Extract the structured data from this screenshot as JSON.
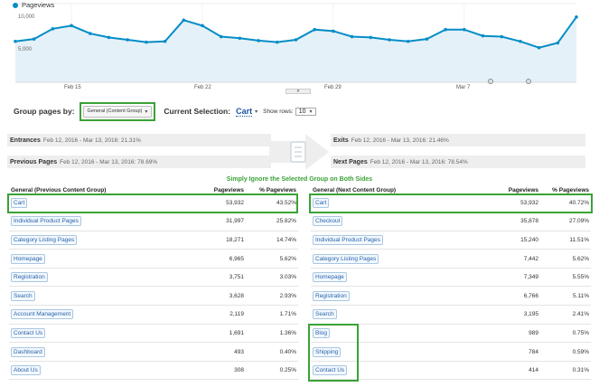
{
  "chart": {
    "legend": "Pageviews",
    "y_ticks": [
      "10,000",
      "5,000"
    ],
    "x_labels": [
      "Feb 15",
      "Feb 22",
      "Feb 29",
      "Mar 7"
    ]
  },
  "chart_data": {
    "type": "area",
    "x": [
      "2016-02-12",
      "2016-02-13",
      "2016-02-14",
      "2016-02-15",
      "2016-02-16",
      "2016-02-17",
      "2016-02-18",
      "2016-02-19",
      "2016-02-20",
      "2016-02-21",
      "2016-02-22",
      "2016-02-23",
      "2016-02-24",
      "2016-02-25",
      "2016-02-26",
      "2016-02-27",
      "2016-02-28",
      "2016-02-29",
      "2016-03-01",
      "2016-03-02",
      "2016-03-03",
      "2016-03-04",
      "2016-03-05",
      "2016-03-06",
      "2016-03-07",
      "2016-03-08",
      "2016-03-09",
      "2016-03-10",
      "2016-03-11",
      "2016-03-12",
      "2016-03-13"
    ],
    "series": [
      {
        "name": "Pageviews",
        "values": [
          5200,
          5500,
          6800,
          7200,
          6200,
          5700,
          5400,
          5100,
          5200,
          7900,
          7200,
          5800,
          5600,
          5300,
          5100,
          5400,
          6700,
          6500,
          5800,
          5700,
          5400,
          5200,
          5500,
          6700,
          6700,
          5900,
          5800,
          5200,
          4400,
          5000,
          8300
        ]
      }
    ],
    "ylim": [
      0,
      10000
    ],
    "y_ticks": [
      5000,
      10000
    ],
    "x_tick_labels": [
      "Feb 15",
      "Feb 22",
      "Feb 29",
      "Mar 7"
    ],
    "grid": true,
    "legend": "top-left"
  },
  "controls": {
    "group_label": "Group pages by:",
    "group_value": "General (Content Group)",
    "selection_label": "Current Selection:",
    "selection_value": "Cart",
    "rows_label": "Show rows:",
    "rows_value": "10"
  },
  "entrances": {
    "label": "Entrances",
    "range": "Feb 12, 2016 - Mar 13, 2016:",
    "value": "21.31%"
  },
  "exits": {
    "label": "Exits",
    "range": "Feb 12, 2016 - Mar 13, 2016:",
    "value": "21.46%"
  },
  "previous_pages": {
    "label": "Previous Pages",
    "range": "Feb 12, 2016 - Mar 13, 2016:",
    "value": "78.69%"
  },
  "next_pages": {
    "label": "Next Pages",
    "range": "Feb 12, 2016 - Mar 13, 2016:",
    "value": "78.54%"
  },
  "note": "Simply Ignore the Selected Group on Both Sides",
  "left_table": {
    "headers": [
      "General (Previous Content Group)",
      "Pageviews",
      "% Pageviews"
    ],
    "rows": [
      {
        "name": "Cart",
        "pv": "53,932",
        "pct": "43.52%"
      },
      {
        "name": "Individual Product Pages",
        "pv": "31,997",
        "pct": "25.82%"
      },
      {
        "name": "Category Listing Pages",
        "pv": "18,271",
        "pct": "14.74%"
      },
      {
        "name": "Homepage",
        "pv": "6,965",
        "pct": "5.62%"
      },
      {
        "name": "Registration",
        "pv": "3,751",
        "pct": "3.03%"
      },
      {
        "name": "Search",
        "pv": "3,628",
        "pct": "2.93%"
      },
      {
        "name": "Account Management",
        "pv": "2,119",
        "pct": "1.71%"
      },
      {
        "name": "Contact Us",
        "pv": "1,691",
        "pct": "1.36%"
      },
      {
        "name": "Dashboard",
        "pv": "493",
        "pct": "0.40%"
      },
      {
        "name": "About Us",
        "pv": "308",
        "pct": "0.25%"
      }
    ]
  },
  "right_table": {
    "headers": [
      "General (Next Content Group)",
      "Pageviews",
      "% Pageviews"
    ],
    "rows": [
      {
        "name": "Cart",
        "pv": "53,932",
        "pct": "40.72%"
      },
      {
        "name": "Checkout",
        "pv": "35,878",
        "pct": "27.09%"
      },
      {
        "name": "Individual Product Pages",
        "pv": "15,240",
        "pct": "11.51%"
      },
      {
        "name": "Category Listing Pages",
        "pv": "7,442",
        "pct": "5.62%"
      },
      {
        "name": "Homepage",
        "pv": "7,349",
        "pct": "5.55%"
      },
      {
        "name": "Registration",
        "pv": "6,766",
        "pct": "5.11%"
      },
      {
        "name": "Search",
        "pv": "3,195",
        "pct": "2.41%"
      },
      {
        "name": "Blog",
        "pv": "989",
        "pct": "0.75%"
      },
      {
        "name": "Shipping",
        "pv": "784",
        "pct": "0.59%"
      },
      {
        "name": "Contact Us",
        "pv": "414",
        "pct": "0.31%"
      }
    ]
  },
  "colors": {
    "line": "#058dc7",
    "area": "#e5f1f9",
    "highlight": "#3aa236",
    "link": "#2a65ad"
  }
}
